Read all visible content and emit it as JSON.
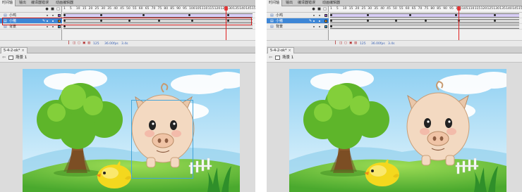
{
  "panel_tabs": [
    "时间轴",
    "输出",
    "编译器错误",
    "动画编辑器"
  ],
  "timeline": {
    "header_icons": [
      "eye-icon",
      "lock-icon",
      "outline-icon"
    ],
    "frame_numbers": [
      "1",
      "5",
      "10",
      "15",
      "20",
      "25",
      "30",
      "35",
      "40",
      "45",
      "50",
      "55",
      "60",
      "65",
      "70",
      "75",
      "80",
      "85",
      "90",
      "95",
      "100",
      "105",
      "110",
      "115",
      "120",
      "125",
      "130",
      "135",
      "140",
      "145",
      "15"
    ],
    "layers": [
      {
        "name": "小鸡",
        "selected": false
      },
      {
        "name": "小猪",
        "selected": true
      },
      {
        "name": "背景",
        "selected": false
      }
    ],
    "footer": {
      "frame": "125",
      "fps": "36.00fps",
      "time": "3.4s"
    }
  },
  "document": {
    "tab_label": "5-4-2-ok*",
    "close_glyph": "×"
  },
  "scene": {
    "label": "场景 1"
  },
  "colors": {
    "selected_layer": "#3d86d6",
    "highlight": "#d01818",
    "playhead": "#e02020",
    "tween_fill": "#c6b8ef",
    "sky": "#aedcf5",
    "grass": "#6cc440"
  }
}
